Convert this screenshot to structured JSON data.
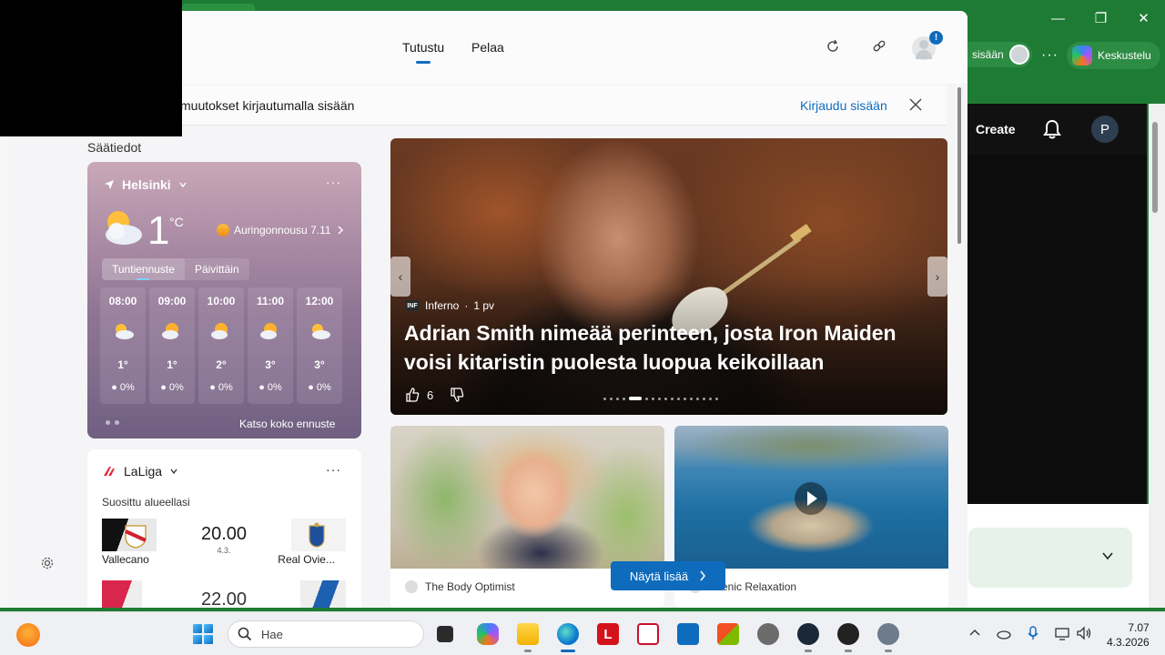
{
  "background_window": {
    "signin_text": "sisään",
    "chat_label": "Keskustelu",
    "create_label": "Create",
    "avatar_letter": "P"
  },
  "header": {
    "tabs": [
      {
        "label": "Tutustu",
        "active": true
      },
      {
        "label": "Pelaa",
        "active": false
      }
    ],
    "notification_badge": "!"
  },
  "signin_banner": {
    "text": "muutokset kirjautumalla sisään",
    "link": "Kirjaudu sisään"
  },
  "weather": {
    "section_label": "Säätiedot",
    "location": "Helsinki",
    "temperature": "1",
    "unit": "°C",
    "sunrise": "Auringonnousu 7.11",
    "tabs": [
      "Tuntiennuste",
      "Päivittäin"
    ],
    "hours": [
      {
        "time": "08:00",
        "temp": "1°",
        "precip": "0%"
      },
      {
        "time": "09:00",
        "temp": "1°",
        "precip": "0%"
      },
      {
        "time": "10:00",
        "temp": "2°",
        "precip": "0%"
      },
      {
        "time": "11:00",
        "temp": "3°",
        "precip": "0%"
      },
      {
        "time": "12:00",
        "temp": "3°",
        "precip": "0%"
      }
    ],
    "full_forecast": "Katso koko ennuste"
  },
  "laliga": {
    "title": "LaLiga",
    "subtitle": "Suosittu alueellasi",
    "match": {
      "home": "Vallecano",
      "away": "Real Ovie...",
      "time": "20.00",
      "date": "4.3."
    },
    "match2_time": "22.00"
  },
  "hero": {
    "source": "Inferno",
    "source_logo": "INF",
    "age": "1 pv",
    "headline": "Adrian Smith nimeää perinteen, josta Iron Maiden voisi kitaristin puolesta luopua keikoillaan",
    "likes": "6"
  },
  "cards": [
    {
      "source": "The Body Optimist"
    },
    {
      "source": "Scenic Relaxation"
    }
  ],
  "show_more": "Näytä lisää",
  "taskbar": {
    "search_placeholder": "Hae",
    "time": "7.07",
    "date": "4.3.2026"
  }
}
